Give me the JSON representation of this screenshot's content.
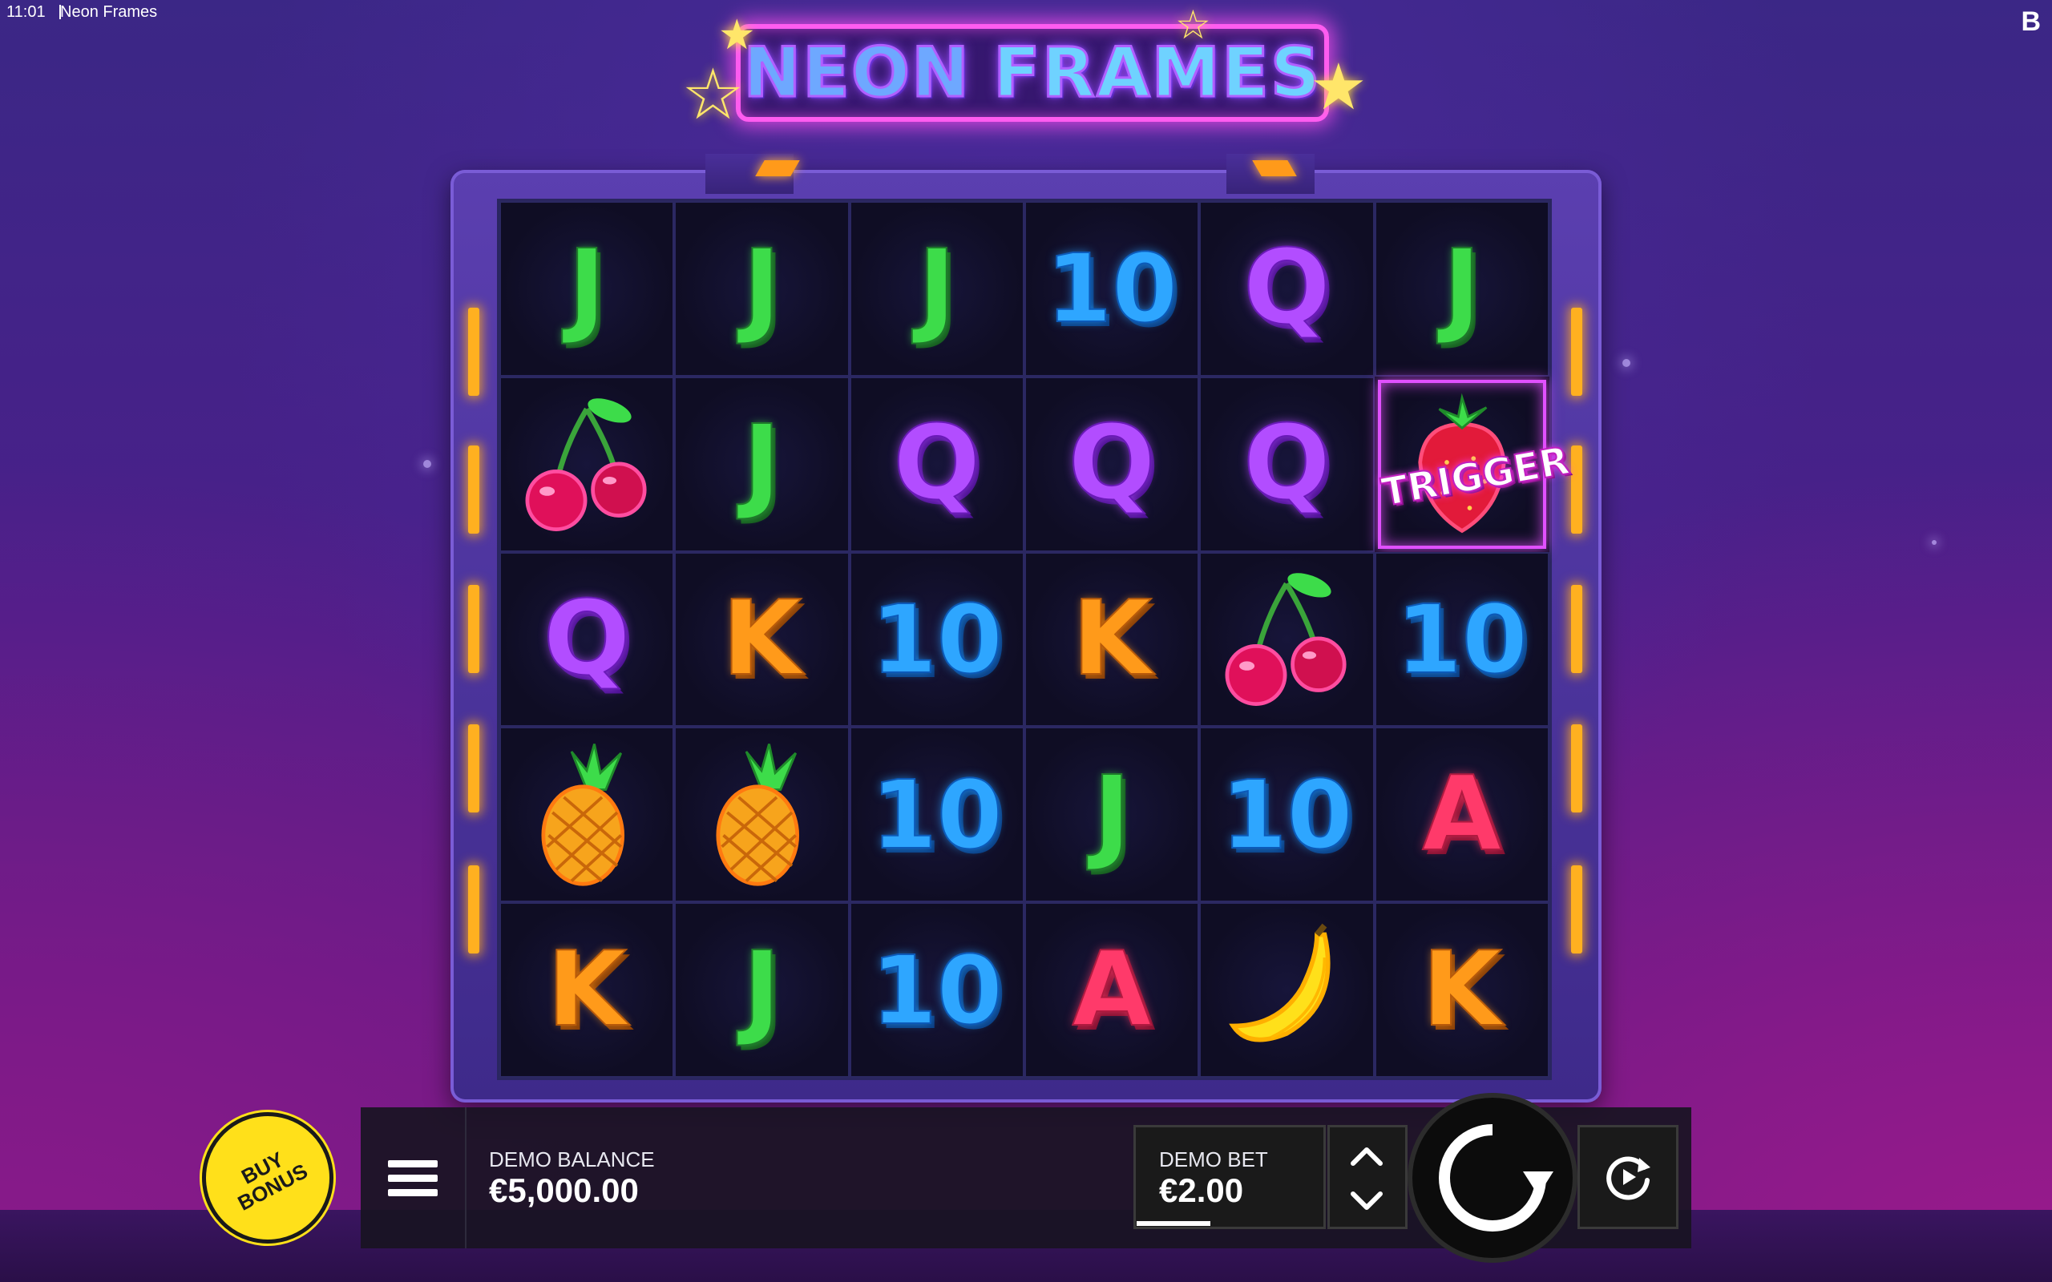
{
  "status_bar": {
    "time": "11:01",
    "title": "Neon Frames",
    "brand_logo": "B"
  },
  "game_title": {
    "word1": "NEON",
    "word2": "FRAMES"
  },
  "colors": {
    "neon_pink": "#ff5cf0",
    "jack_green": "#3ddc4a",
    "ten_blue": "#2ea6ff",
    "queen_purple": "#b24dff",
    "king_orange": "#ff9a1a",
    "ace_red": "#ff3a6a",
    "buy_bonus_yellow": "#ffe01a"
  },
  "reels": {
    "rows": [
      [
        {
          "type": "letter",
          "symbol": "J"
        },
        {
          "type": "letter",
          "symbol": "J"
        },
        {
          "type": "letter",
          "symbol": "J"
        },
        {
          "type": "letter",
          "symbol": "10"
        },
        {
          "type": "letter",
          "symbol": "Q"
        },
        {
          "type": "letter",
          "symbol": "J"
        }
      ],
      [
        {
          "type": "icon",
          "symbol": "cherry-icon"
        },
        {
          "type": "letter",
          "symbol": "J"
        },
        {
          "type": "letter",
          "symbol": "Q"
        },
        {
          "type": "letter",
          "symbol": "Q"
        },
        {
          "type": "letter",
          "symbol": "Q"
        },
        {
          "type": "trigger",
          "symbol": "strawberry-icon",
          "label": "TRIGGER"
        }
      ],
      [
        {
          "type": "letter",
          "symbol": "Q"
        },
        {
          "type": "letter",
          "symbol": "K"
        },
        {
          "type": "letter",
          "symbol": "10"
        },
        {
          "type": "letter",
          "symbol": "K"
        },
        {
          "type": "icon",
          "symbol": "cherry-icon"
        },
        {
          "type": "letter",
          "symbol": "10"
        }
      ],
      [
        {
          "type": "icon",
          "symbol": "pineapple-icon"
        },
        {
          "type": "icon",
          "symbol": "pineapple-icon"
        },
        {
          "type": "letter",
          "symbol": "10"
        },
        {
          "type": "letter",
          "symbol": "J"
        },
        {
          "type": "letter",
          "symbol": "10"
        },
        {
          "type": "letter",
          "symbol": "A"
        }
      ],
      [
        {
          "type": "letter",
          "symbol": "K"
        },
        {
          "type": "letter",
          "symbol": "J"
        },
        {
          "type": "letter",
          "symbol": "10"
        },
        {
          "type": "letter",
          "symbol": "A"
        },
        {
          "type": "icon",
          "symbol": "banana-icon"
        },
        {
          "type": "letter",
          "symbol": "K"
        }
      ]
    ]
  },
  "controls": {
    "buy_bonus_line1": "BUY",
    "buy_bonus_line2": "BONUS",
    "menu_icon": "hamburger-menu-icon",
    "balance_label": "DEMO BALANCE",
    "balance_value": "€5,000.00",
    "bet_label": "DEMO BET",
    "bet_value": "€2.00",
    "spin_icon": "spin-icon",
    "autoplay_icon": "autoplay-icon"
  }
}
